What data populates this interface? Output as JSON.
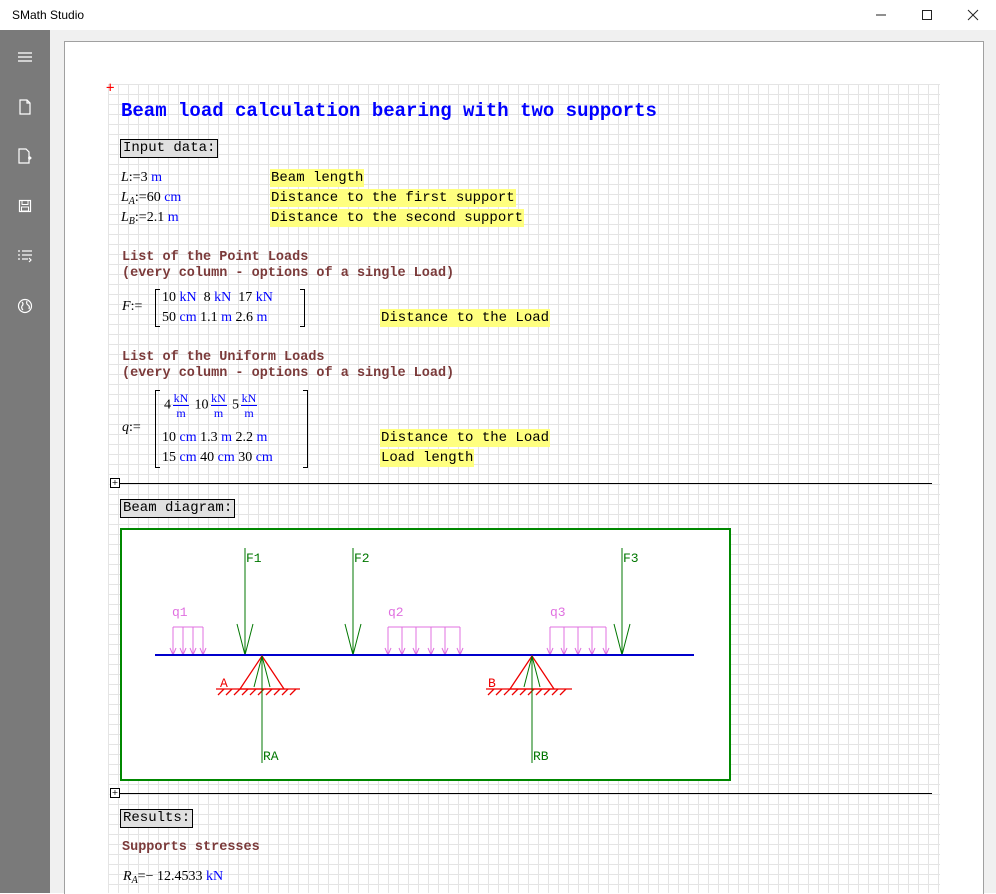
{
  "window": {
    "title": "SMath Studio",
    "minimize": "–",
    "maximize": "☐",
    "close": "✕"
  },
  "sidebar": {
    "icons": [
      "menu-icon",
      "new-document-icon",
      "open-document-icon",
      "save-icon",
      "list-icon",
      "globe-icon"
    ]
  },
  "doc": {
    "title": "Beam load calculation bearing with two supports",
    "input_label": "Input data:",
    "inputs": [
      {
        "name": "L",
        "sub": "",
        "assign": ":=",
        "value": "3",
        "unit": "m",
        "desc": "Beam length"
      },
      {
        "name": "L",
        "sub": "A",
        "assign": ":=",
        "value": "60",
        "unit": "cm",
        "desc": "Distance to the first support"
      },
      {
        "name": "L",
        "sub": "B",
        "assign": ":=",
        "value": "2.1",
        "unit": "m",
        "desc": "Distance to the second support"
      }
    ],
    "point_loads_heading_1": "List of the Point Loads",
    "point_loads_heading_2": "(every column - options of  a single Load)",
    "F_name": "F",
    "F_assign": ":=",
    "F_row1": [
      {
        "v": "10",
        "u": "kN"
      },
      {
        "v": "8",
        "u": "kN"
      },
      {
        "v": "17",
        "u": "kN"
      }
    ],
    "F_row2": [
      {
        "v": "50",
        "u": "cm"
      },
      {
        "v": "1.1",
        "u": "m"
      },
      {
        "v": "2.6",
        "u": "m"
      }
    ],
    "F_desc": "Distance to the Load",
    "uniform_loads_heading_1": "List of the Uniform Loads",
    "uniform_loads_heading_2": "(every column - options of  a single Load)",
    "q_name": "q",
    "q_assign": ":=",
    "q_row1": [
      {
        "v": "4",
        "num": "kN",
        "den": "m"
      },
      {
        "v": "10",
        "num": "kN",
        "den": "m"
      },
      {
        "v": "5",
        "num": "kN",
        "den": "m"
      }
    ],
    "q_row2": [
      {
        "v": "10",
        "u": "cm"
      },
      {
        "v": "1.3",
        "u": "m"
      },
      {
        "v": "2.2",
        "u": "m"
      }
    ],
    "q_row3": [
      {
        "v": "15",
        "u": "cm"
      },
      {
        "v": "40",
        "u": "cm"
      },
      {
        "v": "30",
        "u": "cm"
      }
    ],
    "q_desc_row2": "Distance to the Load",
    "q_desc_row3": "Load length",
    "diagram_label": "Beam diagram:",
    "diagram": {
      "labels": {
        "F1": "F1",
        "F2": "F2",
        "F3": "F3",
        "q1": "q1",
        "q2": "q2",
        "q3": "q3",
        "A": "A",
        "B": "B",
        "RA": "RA",
        "RB": "RB"
      },
      "colors": {
        "beam": "#0000cc",
        "force": "#007700",
        "uniform": "#e070e0",
        "support": "#ee0000",
        "frame": "#008800"
      }
    },
    "results_label": "Results:",
    "supports_heading": "Supports stresses",
    "RA_name": "R",
    "RA_sub": "A",
    "RA_eq": "=",
    "RA_value": "− 12.4533",
    "RA_unit": "kN"
  }
}
